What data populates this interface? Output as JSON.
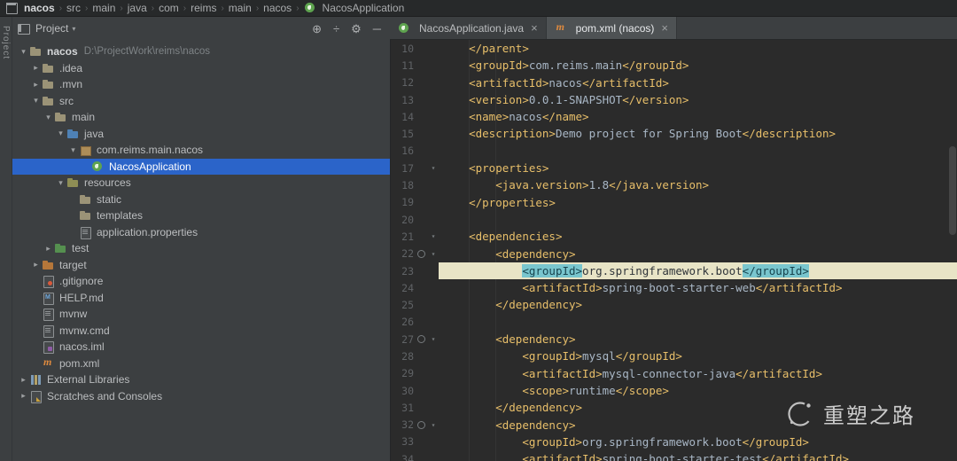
{
  "navigation": {
    "items": [
      {
        "label": "nacos",
        "bold": true,
        "icon": "window"
      },
      {
        "label": "src"
      },
      {
        "label": "main"
      },
      {
        "label": "java"
      },
      {
        "label": "com"
      },
      {
        "label": "reims"
      },
      {
        "label": "main"
      },
      {
        "label": "nacos"
      },
      {
        "label": "NacosApplication",
        "icon": "spring-boot"
      }
    ],
    "separator": "›"
  },
  "tool_window_stripe": {
    "label": "Project"
  },
  "project_panel": {
    "title": "Project",
    "title_caret": "▾",
    "toolbar": [
      {
        "name": "locate-source",
        "glyph": "⊕"
      },
      {
        "name": "collapse-all",
        "glyph": "÷"
      },
      {
        "name": "settings",
        "glyph": "⚙"
      },
      {
        "name": "hide-panel",
        "glyph": "─"
      }
    ],
    "tree": [
      {
        "label": "nacos",
        "suffix": "D:\\ProjectWork\\reims\\nacos",
        "level": 0,
        "exp": true,
        "icon": "project-folder",
        "bold": true
      },
      {
        "label": ".idea",
        "level": 1,
        "exp": false,
        "icon": "folder"
      },
      {
        "label": ".mvn",
        "level": 1,
        "exp": false,
        "icon": "folder"
      },
      {
        "label": "src",
        "level": 1,
        "exp": true,
        "icon": "folder"
      },
      {
        "label": "main",
        "level": 2,
        "exp": true,
        "icon": "folder"
      },
      {
        "label": "java",
        "level": 3,
        "exp": true,
        "icon": "source-folder"
      },
      {
        "label": "com.reims.main.nacos",
        "level": 4,
        "exp": true,
        "icon": "package"
      },
      {
        "label": "NacosApplication",
        "level": 5,
        "icon": "spring-class",
        "selected": true
      },
      {
        "label": "resources",
        "level": 3,
        "exp": true,
        "icon": "resources-folder"
      },
      {
        "label": "static",
        "level": 4,
        "icon": "folder"
      },
      {
        "label": "templates",
        "level": 4,
        "icon": "folder"
      },
      {
        "label": "application.properties",
        "level": 4,
        "icon": "properties-file"
      },
      {
        "label": "test",
        "level": 2,
        "exp": false,
        "icon": "test-folder"
      },
      {
        "label": "target",
        "level": 1,
        "exp": false,
        "icon": "excluded-folder"
      },
      {
        "label": ".gitignore",
        "level": 1,
        "icon": "gitignore-file"
      },
      {
        "label": "HELP.md",
        "level": 1,
        "icon": "markdown-file"
      },
      {
        "label": "mvnw",
        "level": 1,
        "icon": "text-file"
      },
      {
        "label": "mvnw.cmd",
        "level": 1,
        "icon": "cmd-file"
      },
      {
        "label": "nacos.iml",
        "level": 1,
        "icon": "iml-file"
      },
      {
        "label": "pom.xml",
        "level": 1,
        "icon": "maven-file"
      },
      {
        "label": "External Libraries",
        "level": 0,
        "exp": false,
        "icon": "libraries"
      },
      {
        "label": "Scratches and Consoles",
        "level": 0,
        "exp": false,
        "icon": "scratches"
      }
    ]
  },
  "editor": {
    "tabs": [
      {
        "label": "NacosApplication.java",
        "icon": "spring-boot",
        "active": false,
        "close": "×"
      },
      {
        "label": "pom.xml (nacos)",
        "icon": "maven",
        "active": true,
        "close": "×"
      }
    ],
    "lines": [
      {
        "n": 10,
        "s": [
          [
            "v",
            "    "
          ],
          [
            "t",
            "</parent>"
          ]
        ]
      },
      {
        "n": 11,
        "s": [
          [
            "v",
            "    "
          ],
          [
            "t",
            "<groupId>"
          ],
          [
            "v",
            "com.reims.main"
          ],
          [
            "t",
            "</groupId>"
          ]
        ]
      },
      {
        "n": 12,
        "s": [
          [
            "v",
            "    "
          ],
          [
            "t",
            "<artifactId>"
          ],
          [
            "v",
            "nacos"
          ],
          [
            "t",
            "</artifactId>"
          ]
        ]
      },
      {
        "n": 13,
        "s": [
          [
            "v",
            "    "
          ],
          [
            "t",
            "<version>"
          ],
          [
            "v",
            "0.0.1-SNAPSHOT"
          ],
          [
            "t",
            "</version>"
          ]
        ]
      },
      {
        "n": 14,
        "s": [
          [
            "v",
            "    "
          ],
          [
            "t",
            "<name>"
          ],
          [
            "v",
            "nacos"
          ],
          [
            "t",
            "</name>"
          ]
        ]
      },
      {
        "n": 15,
        "s": [
          [
            "v",
            "    "
          ],
          [
            "t",
            "<description>"
          ],
          [
            "v",
            "Demo project for Spring Boot"
          ],
          [
            "t",
            "</description>"
          ]
        ]
      },
      {
        "n": 16,
        "s": []
      },
      {
        "n": 17,
        "fold": true,
        "s": [
          [
            "v",
            "    "
          ],
          [
            "t",
            "<properties>"
          ]
        ]
      },
      {
        "n": 18,
        "s": [
          [
            "v",
            "        "
          ],
          [
            "t",
            "<java.version>"
          ],
          [
            "v",
            "1.8"
          ],
          [
            "t",
            "</java.version>"
          ]
        ]
      },
      {
        "n": 19,
        "s": [
          [
            "v",
            "    "
          ],
          [
            "t",
            "</properties>"
          ]
        ]
      },
      {
        "n": 20,
        "s": []
      },
      {
        "n": 21,
        "fold": true,
        "s": [
          [
            "v",
            "    "
          ],
          [
            "t",
            "<dependencies>"
          ]
        ]
      },
      {
        "n": 22,
        "fold": true,
        "dep": true,
        "s": [
          [
            "v",
            "        "
          ],
          [
            "t",
            "<dependency>"
          ]
        ]
      },
      {
        "n": 23,
        "hl": true,
        "s": [
          [
            "hv",
            "            "
          ],
          [
            "ht",
            "<groupId>"
          ],
          [
            "hv",
            "org.springframework.boot"
          ],
          [
            "ht",
            "</groupId>"
          ]
        ]
      },
      {
        "n": 24,
        "s": [
          [
            "v",
            "            "
          ],
          [
            "t",
            "<artifactId>"
          ],
          [
            "v",
            "spring-boot-starter-web"
          ],
          [
            "t",
            "</artifactId>"
          ]
        ]
      },
      {
        "n": 25,
        "s": [
          [
            "v",
            "        "
          ],
          [
            "t",
            "</dependency>"
          ]
        ]
      },
      {
        "n": 26,
        "s": []
      },
      {
        "n": 27,
        "fold": true,
        "dep": true,
        "s": [
          [
            "v",
            "        "
          ],
          [
            "t",
            "<dependency>"
          ]
        ]
      },
      {
        "n": 28,
        "s": [
          [
            "v",
            "            "
          ],
          [
            "t",
            "<groupId>"
          ],
          [
            "v",
            "mysql"
          ],
          [
            "t",
            "</groupId>"
          ]
        ]
      },
      {
        "n": 29,
        "s": [
          [
            "v",
            "            "
          ],
          [
            "t",
            "<artifactId>"
          ],
          [
            "v",
            "mysql-connector-java"
          ],
          [
            "t",
            "</artifactId>"
          ]
        ]
      },
      {
        "n": 30,
        "s": [
          [
            "v",
            "            "
          ],
          [
            "t",
            "<scope>"
          ],
          [
            "v",
            "runtime"
          ],
          [
            "t",
            "</scope>"
          ]
        ]
      },
      {
        "n": 31,
        "s": [
          [
            "v",
            "        "
          ],
          [
            "t",
            "</dependency>"
          ]
        ]
      },
      {
        "n": 32,
        "fold": true,
        "dep": true,
        "s": [
          [
            "v",
            "        "
          ],
          [
            "t",
            "<dependency>"
          ]
        ]
      },
      {
        "n": 33,
        "s": [
          [
            "v",
            "            "
          ],
          [
            "t",
            "<groupId>"
          ],
          [
            "v",
            "org.springframework.boot"
          ],
          [
            "t",
            "</groupId>"
          ]
        ]
      },
      {
        "n": 34,
        "s": [
          [
            "v",
            "            "
          ],
          [
            "t",
            "<artifactId>"
          ],
          [
            "v",
            "spring-boot-starter-test"
          ],
          [
            "t",
            "</artifactId>"
          ]
        ]
      }
    ]
  },
  "colors": {
    "panel_bg": "#3C3F41",
    "editor_bg": "#2B2B2B",
    "selection_blue": "#2B64C9",
    "tag_orange": "#E8BF6A",
    "value_gray": "#A9B7C6",
    "highlight_band": "#E8E4C6",
    "match_teal": "#79C6CE"
  },
  "watermark": {
    "text": "重塑之路"
  }
}
